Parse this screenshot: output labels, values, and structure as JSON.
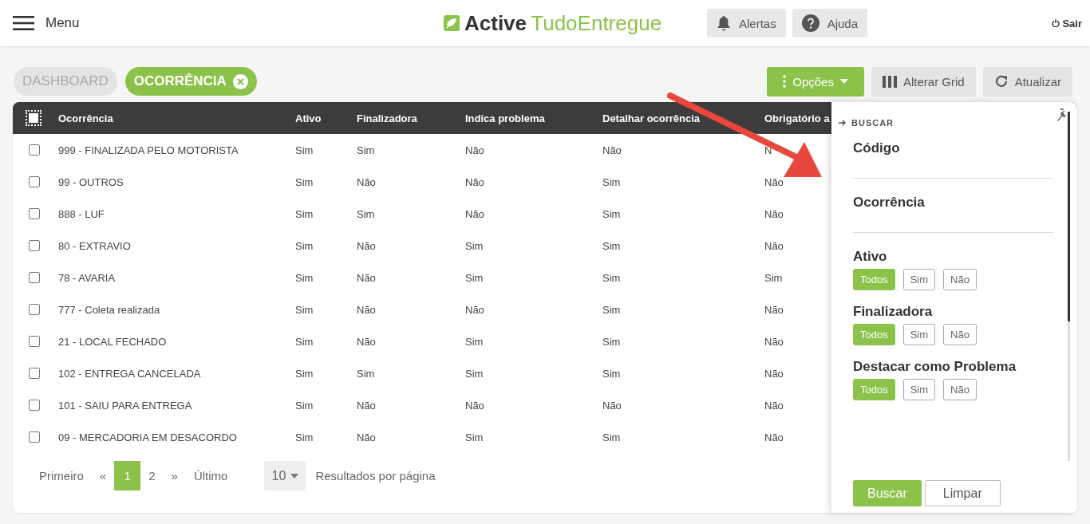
{
  "header": {
    "menu_label": "Menu",
    "logo": {
      "brand": "Active",
      "product": "TudoEntregue"
    },
    "buttons": [
      {
        "label": "Alertas",
        "kind": "bell"
      },
      {
        "label": "Ajuda",
        "kind": "help"
      }
    ],
    "logout": "Sair"
  },
  "tabs": [
    {
      "label": "DASHBOARD",
      "selected": false,
      "closable": false
    },
    {
      "label": "OCORRÊNCIA",
      "selected": true,
      "closable": true
    }
  ],
  "toolbar": [
    {
      "label": "Opções",
      "kind": "options"
    },
    {
      "label": "Alterar Grid",
      "kind": "grid"
    },
    {
      "label": "Atualizar",
      "kind": "refresh"
    }
  ],
  "table": {
    "columns": [
      "Ocorrência",
      "Ativo",
      "Finalizadora",
      "Indica problema",
      "Detalhar ocorrência",
      "Obrigatório a"
    ],
    "select_all_checked": false,
    "rows": [
      {
        "checked": false,
        "cells": [
          "999 - FINALIZADA PELO MOTORISTA",
          "Sim",
          "Sim",
          "Não",
          "Não",
          "N"
        ]
      },
      {
        "checked": false,
        "cells": [
          "99 - OUTROS",
          "Sim",
          "Não",
          "Não",
          "Sim",
          "Não"
        ]
      },
      {
        "checked": false,
        "cells": [
          "888 - LUF",
          "Sim",
          "Sim",
          "Não",
          "Sim",
          "Não"
        ]
      },
      {
        "checked": false,
        "cells": [
          "80 - EXTRAVIO",
          "Sim",
          "Não",
          "Sim",
          "Sim",
          "Não"
        ]
      },
      {
        "checked": false,
        "cells": [
          "78 - AVARIA",
          "Sim",
          "Não",
          "Sim",
          "Sim",
          "Sim"
        ]
      },
      {
        "checked": false,
        "cells": [
          "777 - Coleta realizada",
          "Sim",
          "Não",
          "Não",
          "Sim",
          "Não"
        ]
      },
      {
        "checked": false,
        "cells": [
          "21 - LOCAL FECHADO",
          "Sim",
          "Não",
          "Sim",
          "Sim",
          "Não"
        ]
      },
      {
        "checked": false,
        "cells": [
          "102 - ENTREGA CANCELADA",
          "Sim",
          "Sim",
          "Sim",
          "Sim",
          "Não"
        ]
      },
      {
        "checked": false,
        "cells": [
          "101 - SAIU PARA ENTREGA",
          "Sim",
          "Não",
          "Não",
          "Não",
          "Não"
        ]
      },
      {
        "checked": false,
        "cells": [
          "09 - MERCADORIA EM DESACORDO",
          "Sim",
          "Não",
          "Sim",
          "Sim",
          "Não"
        ]
      }
    ]
  },
  "pagination": {
    "first": "Primeiro",
    "prev": "«",
    "pages": [
      {
        "label": "1",
        "selected": true
      },
      {
        "label": "2",
        "selected": false
      }
    ],
    "next": "»",
    "last": "Último",
    "page_size": "10",
    "page_size_label": "Resultados por página"
  },
  "search_panel": {
    "title": "BUSCAR",
    "text_filters": [
      "Código",
      "Ocorrência"
    ],
    "choice_filters": [
      {
        "label": "Ativo",
        "options": [
          {
            "label": "Todos",
            "selected": true
          },
          {
            "label": "Sim",
            "selected": false
          },
          {
            "label": "Não",
            "selected": false
          }
        ]
      },
      {
        "label": "Finalizadora",
        "options": [
          {
            "label": "Todos",
            "selected": true
          },
          {
            "label": "Sim",
            "selected": false
          },
          {
            "label": "Não",
            "selected": false
          }
        ]
      },
      {
        "label": "Destacar como Problema",
        "options": [
          {
            "label": "Todos",
            "selected": true
          },
          {
            "label": "Sim",
            "selected": false
          },
          {
            "label": "Não",
            "selected": false
          }
        ]
      }
    ],
    "buttons": [
      {
        "label": "Buscar",
        "kind": "primary"
      },
      {
        "label": "Limpar",
        "kind": "secondary"
      }
    ]
  }
}
